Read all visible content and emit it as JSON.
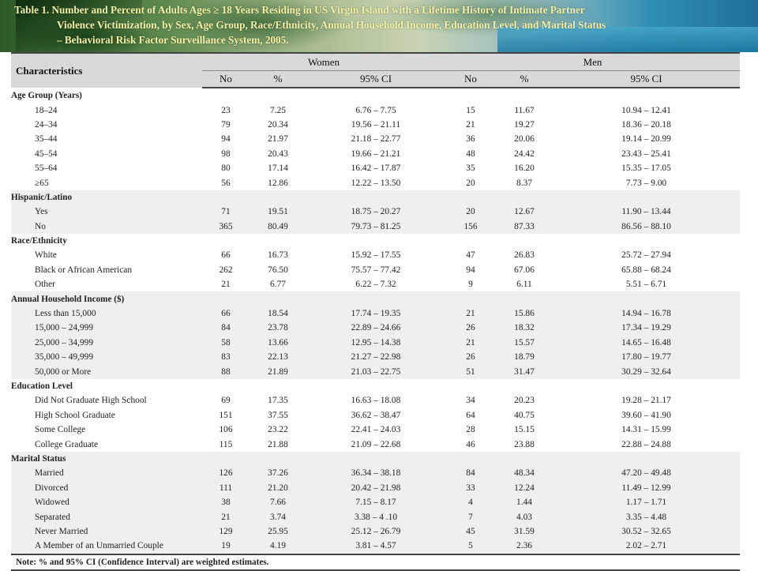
{
  "title": {
    "line1": "Table 1. Number and Percent of Adults Ages ≥ 18 Years Residing in US Virgin Island with a Lifetime History of Intimate Partner",
    "line2": "Violence Victimization, by Sex, Age Group, Race/Ethnicity, Annual  Household Income, Education Level, and Marital Status",
    "line3": "– Behavioral Risk Factor Surveillance System, 2005."
  },
  "header": {
    "characteristics": "Characteristics",
    "women": "Women",
    "men": "Men",
    "no": "No",
    "pct": "%",
    "ci": "95% CI"
  },
  "groups": [
    {
      "title": "Age Group (Years)",
      "shaded": false,
      "rows": [
        {
          "label": "18–24",
          "w_no": "23",
          "w_pct": "7.25",
          "w_ci": "6.76 – 7.75",
          "m_no": "15",
          "m_pct": "11.67",
          "m_ci": "10.94 – 12.41"
        },
        {
          "label": "24–34",
          "w_no": "79",
          "w_pct": "20.34",
          "w_ci": "19.56 – 21.11",
          "m_no": "21",
          "m_pct": "19.27",
          "m_ci": "18.36 – 20.18"
        },
        {
          "label": "35–44",
          "w_no": "94",
          "w_pct": "21.97",
          "w_ci": "21.18 – 22.77",
          "m_no": "36",
          "m_pct": "20.06",
          "m_ci": "19.14 – 20.99"
        },
        {
          "label": "45–54",
          "w_no": "98",
          "w_pct": "20.43",
          "w_ci": "19.66 – 21.21",
          "m_no": "48",
          "m_pct": "24.42",
          "m_ci": "23.43 – 25.41"
        },
        {
          "label": "55–64",
          "w_no": "80",
          "w_pct": "17.14",
          "w_ci": "16.42 – 17.87",
          "m_no": "35",
          "m_pct": "16.20",
          "m_ci": "15.35 – 17.05"
        },
        {
          "label": "  ≥65",
          "w_no": "56",
          "w_pct": "12.86",
          "w_ci": "12.22 – 13.50",
          "m_no": "20",
          "m_pct": "8.37",
          "m_ci": "7.73 – 9.00"
        }
      ]
    },
    {
      "title": "Hispanic/Latino",
      "shaded": true,
      "rows": [
        {
          "label": "Yes",
          "w_no": "71",
          "w_pct": "19.51",
          "w_ci": "18.75 – 20.27",
          "m_no": "20",
          "m_pct": "12.67",
          "m_ci": "11.90 – 13.44"
        },
        {
          "label": "No",
          "w_no": "365",
          "w_pct": "80.49",
          "w_ci": "79.73 – 81.25",
          "m_no": "156",
          "m_pct": "87.33",
          "m_ci": "86.56 – 88.10"
        }
      ]
    },
    {
      "title": "Race/Ethnicity",
      "shaded": false,
      "rows": [
        {
          "label": "White",
          "w_no": "66",
          "w_pct": "16.73",
          "w_ci": "15.92 – 17.55",
          "m_no": "47",
          "m_pct": "26.83",
          "m_ci": "25.72 – 27.94"
        },
        {
          "label": "Black or African American",
          "w_no": "262",
          "w_pct": "76.50",
          "w_ci": "75.57 – 77.42",
          "m_no": "94",
          "m_pct": "67.06",
          "m_ci": "65.88 – 68.24"
        },
        {
          "label": "Other",
          "w_no": "21",
          "w_pct": "6.77",
          "w_ci": "6.22 – 7.32",
          "m_no": "9",
          "m_pct": "6.11",
          "m_ci": "5.51 – 6.71"
        }
      ]
    },
    {
      "title": "Annual Household Income ($)",
      "shaded": true,
      "rows": [
        {
          "label": "Less than 15,000",
          "w_no": "66",
          "w_pct": "18.54",
          "w_ci": "17.74 – 19.35",
          "m_no": "21",
          "m_pct": "15.86",
          "m_ci": "14.94 – 16.78"
        },
        {
          "label": "15,000 – 24,999",
          "w_no": "84",
          "w_pct": "23.78",
          "w_ci": "22.89 – 24.66",
          "m_no": "26",
          "m_pct": "18.32",
          "m_ci": "17.34 – 19.29"
        },
        {
          "label": "25,000 – 34,999",
          "w_no": "58",
          "w_pct": "13.66",
          "w_ci": "12.95 – 14.38",
          "m_no": "21",
          "m_pct": "15.57",
          "m_ci": "14.65 – 16.48"
        },
        {
          "label": "35,000 – 49,999",
          "w_no": "83",
          "w_pct": "22.13",
          "w_ci": "21.27 – 22.98",
          "m_no": "26",
          "m_pct": "18.79",
          "m_ci": "17.80 – 19.77"
        },
        {
          "label": "50,000 or More",
          "w_no": "88",
          "w_pct": "21.89",
          "w_ci": "21.03 – 22.75",
          "m_no": "51",
          "m_pct": "31.47",
          "m_ci": "30.29 – 32.64"
        }
      ]
    },
    {
      "title": "Education Level",
      "shaded": false,
      "rows": [
        {
          "label": "Did Not Graduate High School",
          "w_no": "69",
          "w_pct": "17.35",
          "w_ci": "16.63 – 18.08",
          "m_no": "34",
          "m_pct": "20.23",
          "m_ci": "19.28 – 21.17"
        },
        {
          "label": "High School Graduate",
          "w_no": "151",
          "w_pct": "37.55",
          "w_ci": "36.62 – 38.47",
          "m_no": "64",
          "m_pct": "40.75",
          "m_ci": "39.60 – 41.90"
        },
        {
          "label": "Some College",
          "w_no": "106",
          "w_pct": "23.22",
          "w_ci": "22.41 – 24.03",
          "m_no": "28",
          "m_pct": "15.15",
          "m_ci": "14.31 – 15.99"
        },
        {
          "label": "College Graduate",
          "w_no": "115",
          "w_pct": "21.88",
          "w_ci": "21.09 – 22.68",
          "m_no": "46",
          "m_pct": "23.88",
          "m_ci": "22.88 – 24.88"
        }
      ]
    },
    {
      "title": "Marital Status",
      "shaded": true,
      "rows": [
        {
          "label": " Married",
          "w_no": "126",
          "w_pct": "37.26",
          "w_ci": "36.34 – 38.18",
          "m_no": "84",
          "m_pct": "48.34",
          "m_ci": "47.20 – 49.48"
        },
        {
          "label": " Divorced",
          "w_no": "111",
          "w_pct": "21.20",
          "w_ci": "20.42 – 21.98",
          "m_no": "33",
          "m_pct": "12.24",
          "m_ci": "11.49 – 12.99"
        },
        {
          "label": " Widowed",
          "w_no": "38",
          "w_pct": "7.66",
          "w_ci": "7.15 – 8.17",
          "m_no": "4",
          "m_pct": "1.44",
          "m_ci": "1.17 – 1.71"
        },
        {
          "label": " Separated",
          "w_no": "21",
          "w_pct": "3.74",
          "w_ci": "3.38 – 4 .10",
          "m_no": "7",
          "m_pct": "4.03",
          "m_ci": "3.35 – 4.48"
        },
        {
          "label": " Never Married",
          "w_no": "129",
          "w_pct": "25.95",
          "w_ci": "25.12 – 26.79",
          "m_no": "45",
          "m_pct": "31.59",
          "m_ci": "30.52 – 32.65"
        },
        {
          "label": " A Member of an Unmarried Couple",
          "w_no": "19",
          "w_pct": "4.19",
          "w_ci": "3.81 – 4.57",
          "m_no": "5",
          "m_pct": "2.36",
          "m_ci": "2.02 – 2.71"
        }
      ]
    }
  ],
  "footnote": "Note:  % and 95% CI (Confidence Interval) are weighted estimates.",
  "colors": {
    "title_text": "#f2f0a8",
    "header_bg": "#d9d9d9",
    "shade_bg": "#efefef"
  }
}
